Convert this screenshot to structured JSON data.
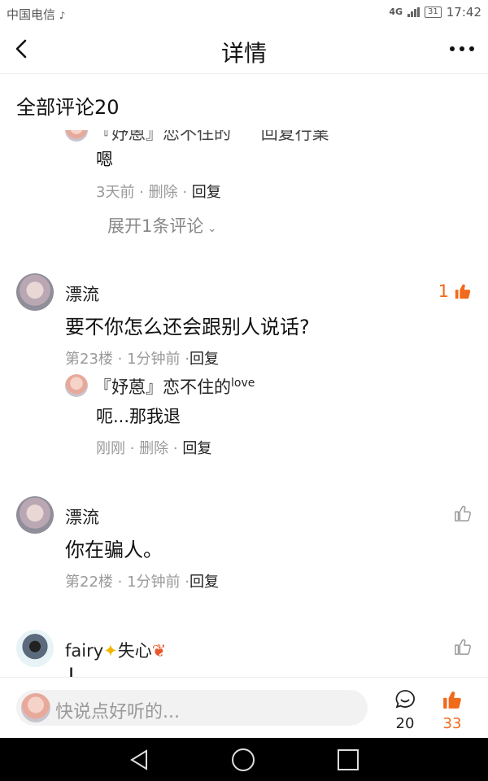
{
  "status": {
    "carrier": "中国电信",
    "network": "4G",
    "battery": "31",
    "time": "17:42"
  },
  "nav": {
    "title": "详情"
  },
  "section": {
    "title": "全部评论20"
  },
  "partial": {
    "name_prefix": "『妤蒽』恋不住的",
    "reply_hint": "回复行業",
    "text": "嗯",
    "time": "3天前",
    "delete": "删除",
    "reply": "回复"
  },
  "expand": {
    "label": "展开1条评论"
  },
  "comments": [
    {
      "name": "漂流",
      "likes": "1",
      "text": "要不你怎么还会跟别人说话?",
      "floor": "第23楼",
      "time": "1分钟前",
      "reply": "回复",
      "sub": {
        "name": "『妤蒽』恋不住的",
        "name_sup": "love",
        "text": "呃...那我退",
        "time": "刚刚",
        "delete": "删除",
        "reply": "回复"
      }
    },
    {
      "name": "漂流",
      "text": "你在骗人。",
      "floor": "第22楼",
      "time": "1分钟前",
      "reply": "回复"
    },
    {
      "name": "fairy",
      "name_suffix": "失心",
      "text": "L"
    }
  ],
  "bottom": {
    "placeholder": "快说点好听的...",
    "comment_count": "20",
    "like_count": "33"
  },
  "colors": {
    "accent": "#f26a1b"
  }
}
